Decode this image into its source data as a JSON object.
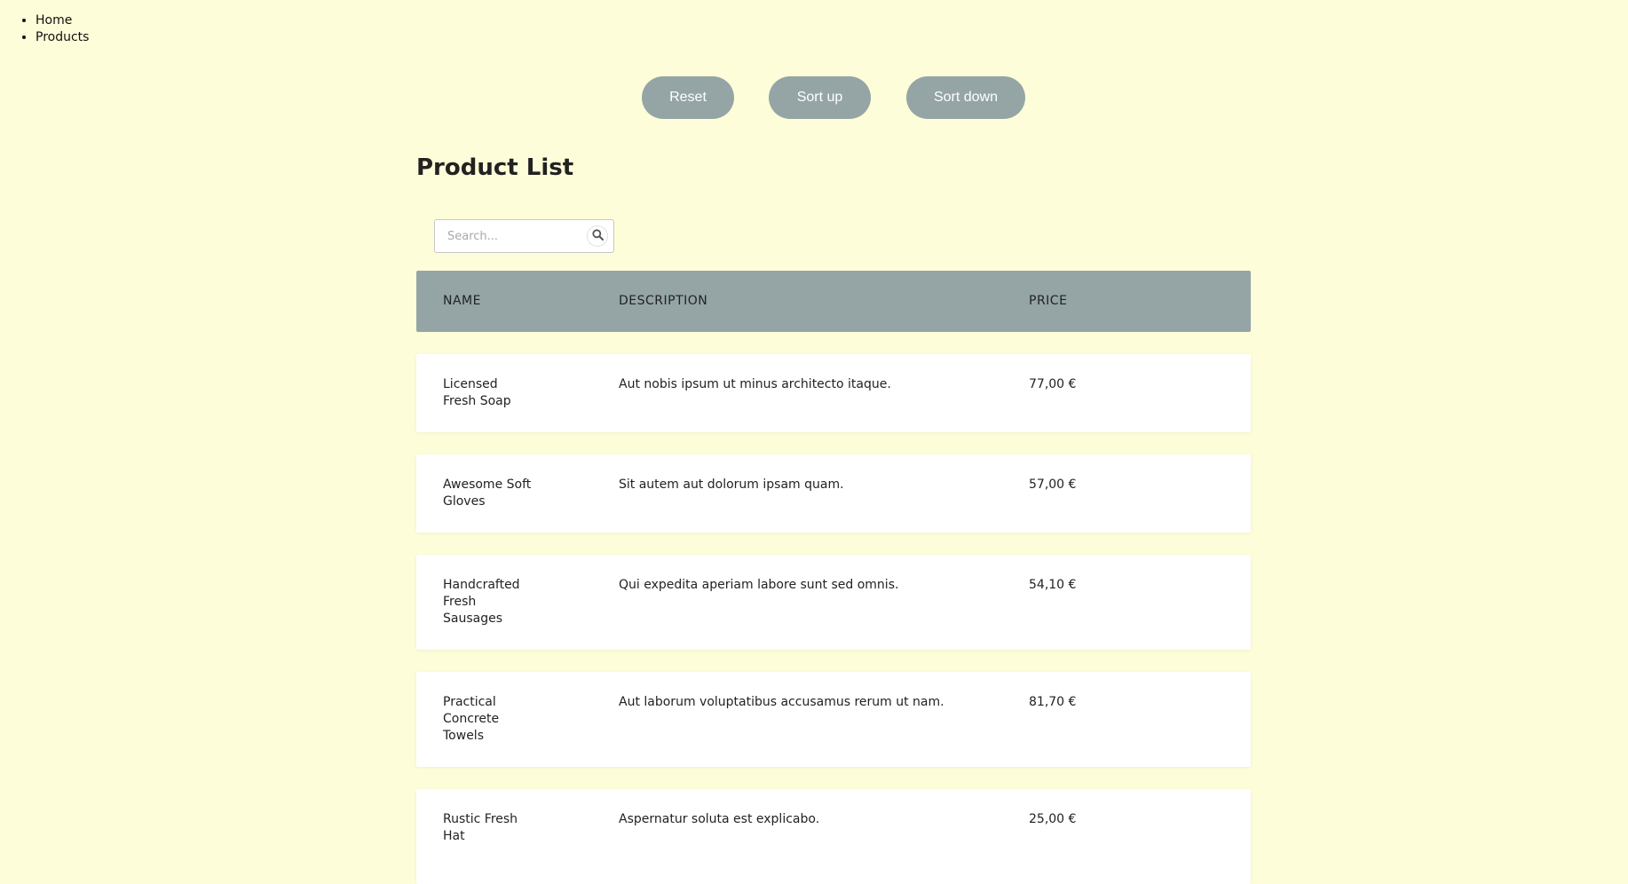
{
  "nav": {
    "items": [
      {
        "label": "Home"
      },
      {
        "label": "Products"
      }
    ]
  },
  "controls": {
    "reset_label": "Reset",
    "sort_up_label": "Sort up",
    "sort_down_label": "Sort down",
    "button_color": "#95a5a6"
  },
  "page": {
    "title": "Product List",
    "background": "#fefdd9"
  },
  "search": {
    "placeholder": "Search...",
    "value": "",
    "icon": "search-icon"
  },
  "table": {
    "headers": {
      "name": "NAME",
      "description": "DESCRIPTION",
      "price": "PRICE"
    },
    "rows": [
      {
        "name": "Licensed Fresh Soap",
        "description": "Aut nobis ipsum ut minus architecto itaque.",
        "price": "77,00 €"
      },
      {
        "name": "Awesome Soft Gloves",
        "description": "Sit autem aut dolorum ipsam quam.",
        "price": "57,00 €"
      },
      {
        "name": "Handcrafted Fresh Sausages",
        "description": "Qui expedita aperiam labore sunt sed omnis.",
        "price": "54,10 €"
      },
      {
        "name": "Practical Concrete Towels",
        "description": "Aut laborum voluptatibus accusamus rerum ut nam.",
        "price": "81,70 €"
      },
      {
        "name": "Rustic Fresh Hat",
        "description": "Aspernatur soluta est explicabo.",
        "price": "25,00 €"
      }
    ]
  }
}
